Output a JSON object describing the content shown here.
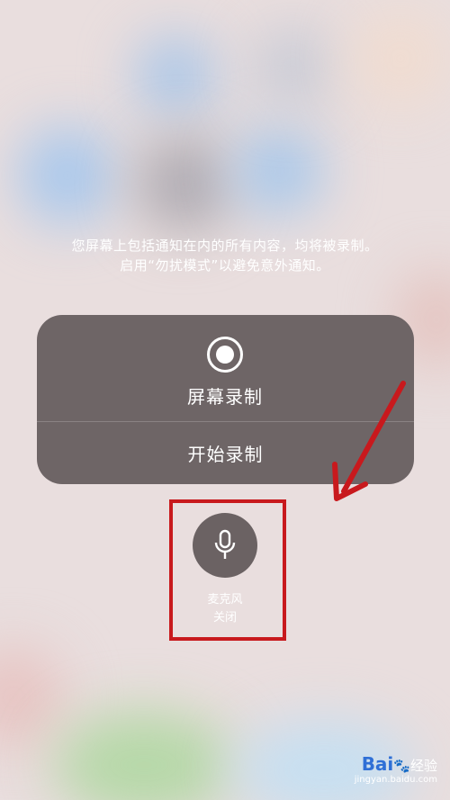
{
  "notice": {
    "line1": "您屏幕上包括通知在内的所有内容，均将被录制。",
    "line2": "启用“勿扰模式”以避免意外通知。"
  },
  "recording_card": {
    "title": "屏幕录制",
    "start_button": "开始录制",
    "icon": "record-icon"
  },
  "microphone": {
    "label": "麦克风",
    "status": "关闭",
    "icon": "microphone-icon"
  },
  "annotation": {
    "highlight_color": "#c8191d"
  },
  "watermark": {
    "brand_text": "Bai",
    "brand_suffix": "经验",
    "url": "jingyan.baidu.com"
  }
}
